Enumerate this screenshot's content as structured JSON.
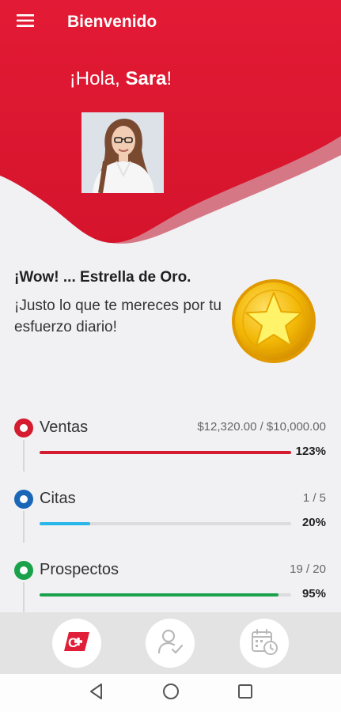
{
  "header": {
    "title": "Bienvenido"
  },
  "greeting": {
    "prefix": "¡Hola, ",
    "name": "Sara",
    "suffix": "!"
  },
  "achievement": {
    "title": "¡Wow! ... Estrella de Oro.",
    "message": "¡Justo lo que te mereces por tu esfuerzo diario!"
  },
  "metrics": [
    {
      "label": "Ventas",
      "ratio": "$12,320.00 / $10,000.00",
      "percent": "123%",
      "progress": 1.23,
      "color": "#d41b30"
    },
    {
      "label": "Citas",
      "ratio": "1 / 5",
      "percent": "20%",
      "progress": 0.2,
      "color": "#29b6e8"
    },
    {
      "label": "Prospectos",
      "ratio": "19 / 20",
      "percent": "95%",
      "progress": 0.95,
      "color": "#19a24a"
    }
  ],
  "bottom_nav": {
    "items": [
      "logo-icon",
      "user-check-icon",
      "calendar-clock-icon"
    ]
  },
  "colors": {
    "brand": "#e01e37",
    "brand_dark": "#c9142a",
    "gold": "#f2b705"
  }
}
